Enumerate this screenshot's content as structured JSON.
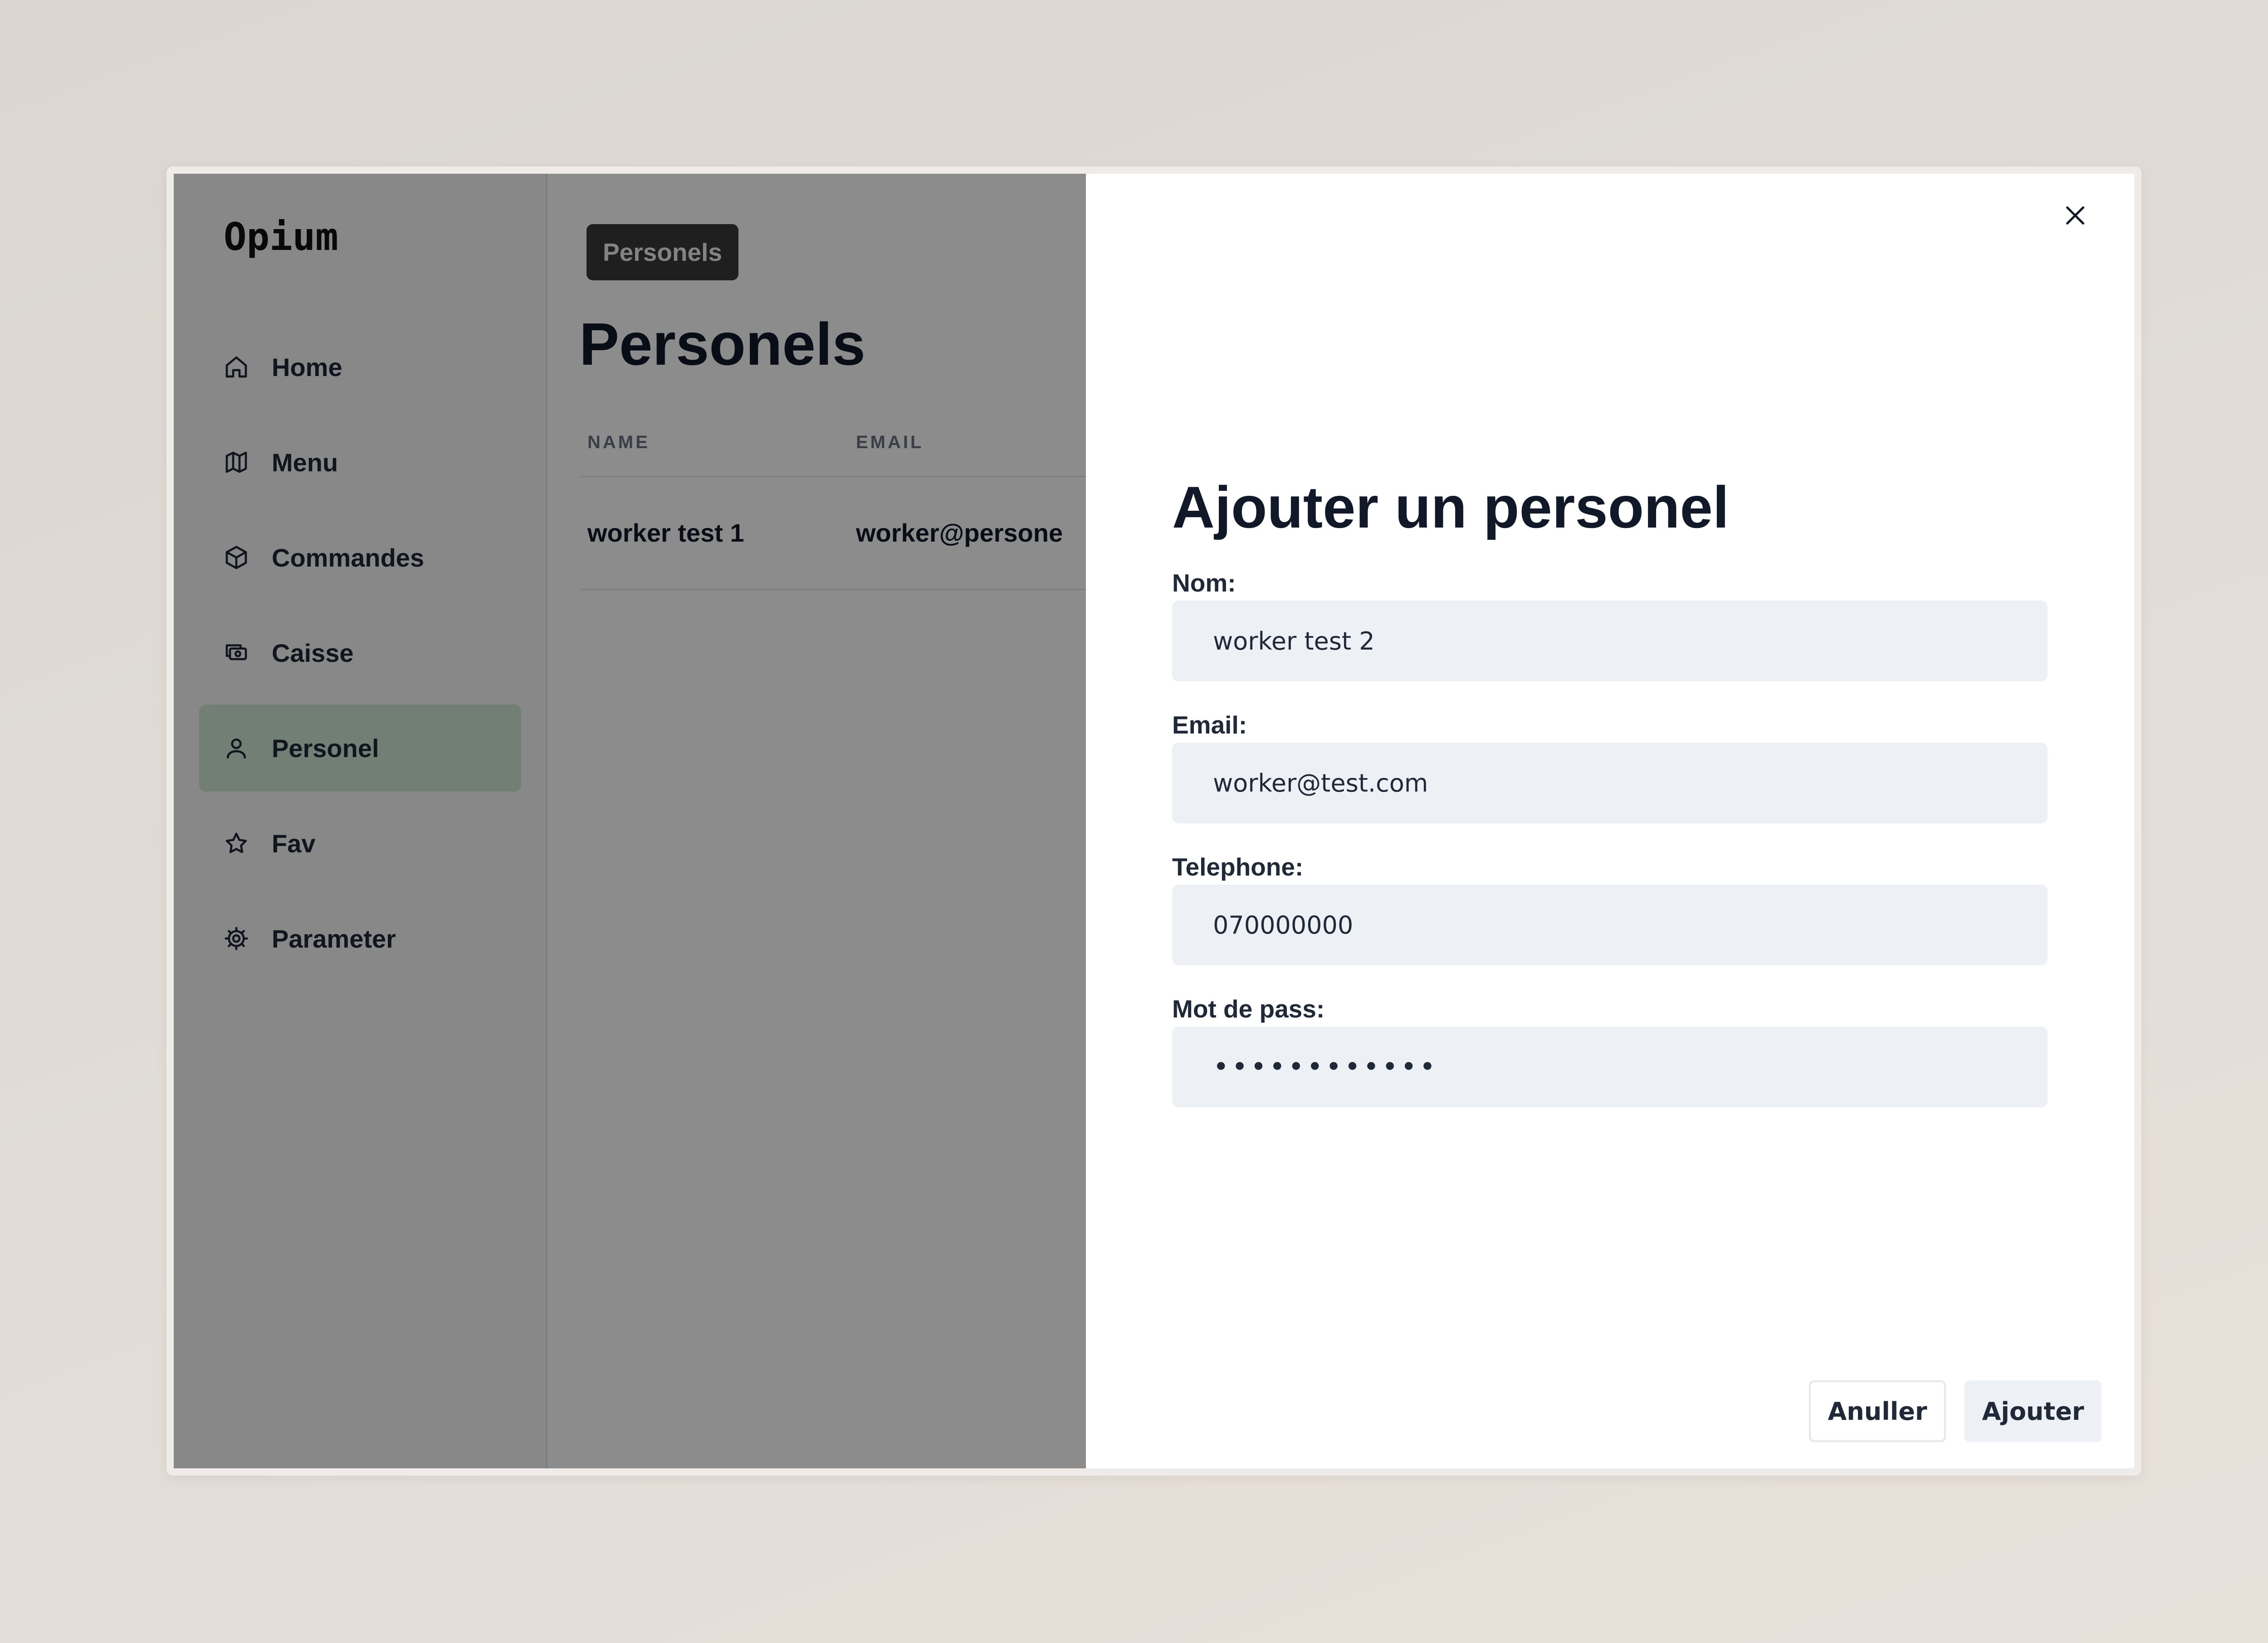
{
  "app": {
    "logo": "Opium"
  },
  "sidebar": {
    "items": [
      {
        "label": "Home",
        "icon": "home-icon"
      },
      {
        "label": "Menu",
        "icon": "map-icon"
      },
      {
        "label": "Commandes",
        "icon": "box-icon"
      },
      {
        "label": "Caisse",
        "icon": "cash-register-icon"
      },
      {
        "label": "Personel",
        "icon": "user-icon",
        "active": true
      },
      {
        "label": "Fav",
        "icon": "star-icon"
      },
      {
        "label": "Parameter",
        "icon": "gear-icon"
      }
    ]
  },
  "main": {
    "breadcrumb": "Personels",
    "title": "Personels",
    "table": {
      "columns": [
        "NAME",
        "EMAIL"
      ],
      "rows": [
        {
          "name": "worker test 1",
          "email": "worker@persone"
        }
      ]
    }
  },
  "drawer": {
    "title": "Ajouter un personel",
    "fields": {
      "nom": {
        "label": "Nom:",
        "value": "worker test 2"
      },
      "email": {
        "label": "Email:",
        "value": "worker@test.com"
      },
      "telephone": {
        "label": "Telephone:",
        "value": "070000000"
      },
      "password": {
        "label": "Mot de pass:",
        "value": "••••••••••••"
      }
    },
    "cancel_label": "Anuller",
    "submit_label": "Ajouter",
    "close_icon": "close-icon"
  },
  "colors": {
    "active_nav": "#cfe8d6",
    "input_bg": "#edf0f4",
    "overlay": "rgba(0,0,0,0.45)"
  }
}
